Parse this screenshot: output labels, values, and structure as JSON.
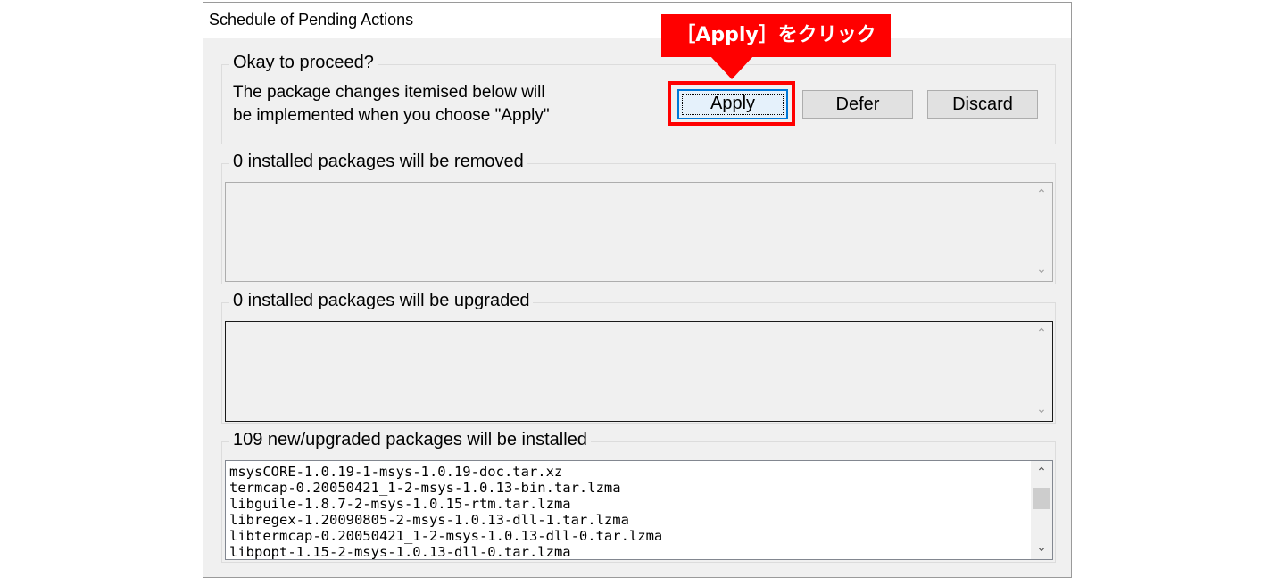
{
  "window": {
    "title": "Schedule of Pending Actions"
  },
  "proceed_group": {
    "title": "Okay to proceed?",
    "description_line1": "The package changes itemised below will",
    "description_line2": "be implemented when you choose \"Apply\"",
    "buttons": {
      "apply": "Apply",
      "defer": "Defer",
      "discard": "Discard"
    }
  },
  "removed_group": {
    "title": "0 installed packages will be removed",
    "items": []
  },
  "upgraded_group": {
    "title": "0 installed packages will be upgraded",
    "items": []
  },
  "installed_group": {
    "title": "109 new/upgraded packages will be installed",
    "items": [
      "msysCORE-1.0.19-1-msys-1.0.19-doc.tar.xz",
      "termcap-0.20050421_1-2-msys-1.0.13-bin.tar.lzma",
      "libguile-1.8.7-2-msys-1.0.15-rtm.tar.lzma",
      "libregex-1.20090805-2-msys-1.0.13-dll-1.tar.lzma",
      "libtermcap-0.20050421_1-2-msys-1.0.13-dll-0.tar.lzma",
      "libpopt-1.15-2-msys-1.0.13-dll-0.tar.lzma"
    ]
  },
  "annotation": {
    "callout_text": "［Apply］をクリック",
    "color": "#ff0000"
  },
  "icons": {
    "scroll_up": "chevron-up-icon",
    "scroll_down": "chevron-down-icon"
  }
}
